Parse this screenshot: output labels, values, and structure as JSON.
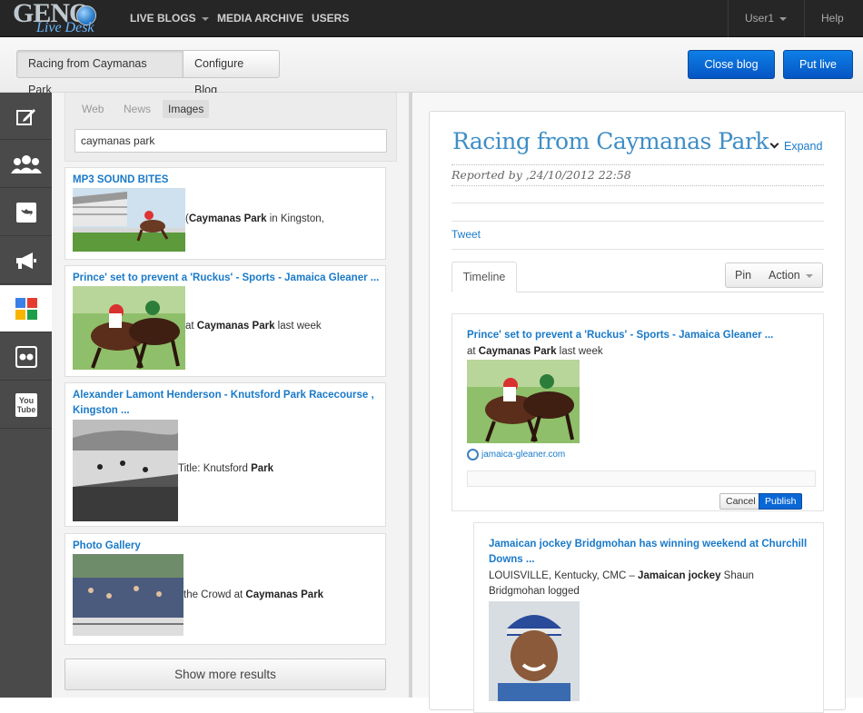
{
  "topbar": {
    "logo_text": "GENO",
    "logo_sub": "Live Desk",
    "nav": [
      {
        "label": "LIVE BLOGS"
      },
      {
        "label": "MEDIA ARCHIVE"
      },
      {
        "label": "USERS"
      }
    ],
    "user": "User1",
    "help": "Help"
  },
  "subbar": {
    "blog_tab": "Racing from Caymanas Park",
    "configure_tab": "Configure Blog",
    "close_button": "Close blog",
    "put_live_button": "Put live"
  },
  "sidebar": {
    "items": [
      {
        "icon": "edit-icon"
      },
      {
        "icon": "users-icon"
      },
      {
        "icon": "twitter-icon"
      },
      {
        "icon": "megaphone-icon"
      },
      {
        "icon": "google-icon"
      },
      {
        "icon": "flickr-icon"
      },
      {
        "icon": "youtube-icon"
      }
    ]
  },
  "search": {
    "tabs": [
      "Web",
      "News",
      "Images"
    ],
    "active_tab": "Images",
    "query": "caymanas park"
  },
  "results": [
    {
      "title": "MP3 SOUND BITES",
      "text_pre": "(",
      "text_bold": "Caymanas Park",
      "text_post": " in Kingston,"
    },
    {
      "title": "Prince' set to prevent a 'Ruckus' - Sports - Jamaica Gleaner ...",
      "text_pre": "at ",
      "text_bold": "Caymanas Park",
      "text_post": " last week"
    },
    {
      "title_line1": "Alexander Lamont Henderson - Knutsford Park Racecourse ,",
      "title_line2": "Kingston ...",
      "text_pre": "Title: Knutsford ",
      "text_bold": "Park",
      "text_post": ""
    },
    {
      "title": "Photo Gallery",
      "text_pre": "the Crowd at ",
      "text_bold": "Caymanas Park",
      "text_post": ""
    }
  ],
  "show_more": "Show more results",
  "blog": {
    "title": "Racing from Caymanas Park",
    "expand": "Expand",
    "reported_by": "Reported by ,24/10/2012 22:58",
    "tweet": "Tweet",
    "timeline_tab": "Timeline",
    "pin": "Pin",
    "action": "Action",
    "post1": {
      "title": "Prince' set to prevent a 'Ruckus' - Sports - Jamaica Gleaner ...",
      "text_pre": "at ",
      "text_bold": "Caymanas Park",
      "text_post": " last week",
      "source": "jamaica-gleaner.com",
      "cancel": "Cancel",
      "publish": "Publish"
    },
    "post2": {
      "title_line1": "Jamaican jockey Bridgmohan has winning weekend at Churchill",
      "title_line2": "Downs ...",
      "text_line1_pre": "LOUISVILLE, Kentucky, CMC – ",
      "text_line1_bold": "Jamaican jockey",
      "text_line1_post": " Shaun",
      "text_line2": "Bridgmohan logged"
    }
  },
  "colors": {
    "accent": "#1a7ac9",
    "button_blue": "#0a67d6",
    "topbar": "#262626"
  }
}
